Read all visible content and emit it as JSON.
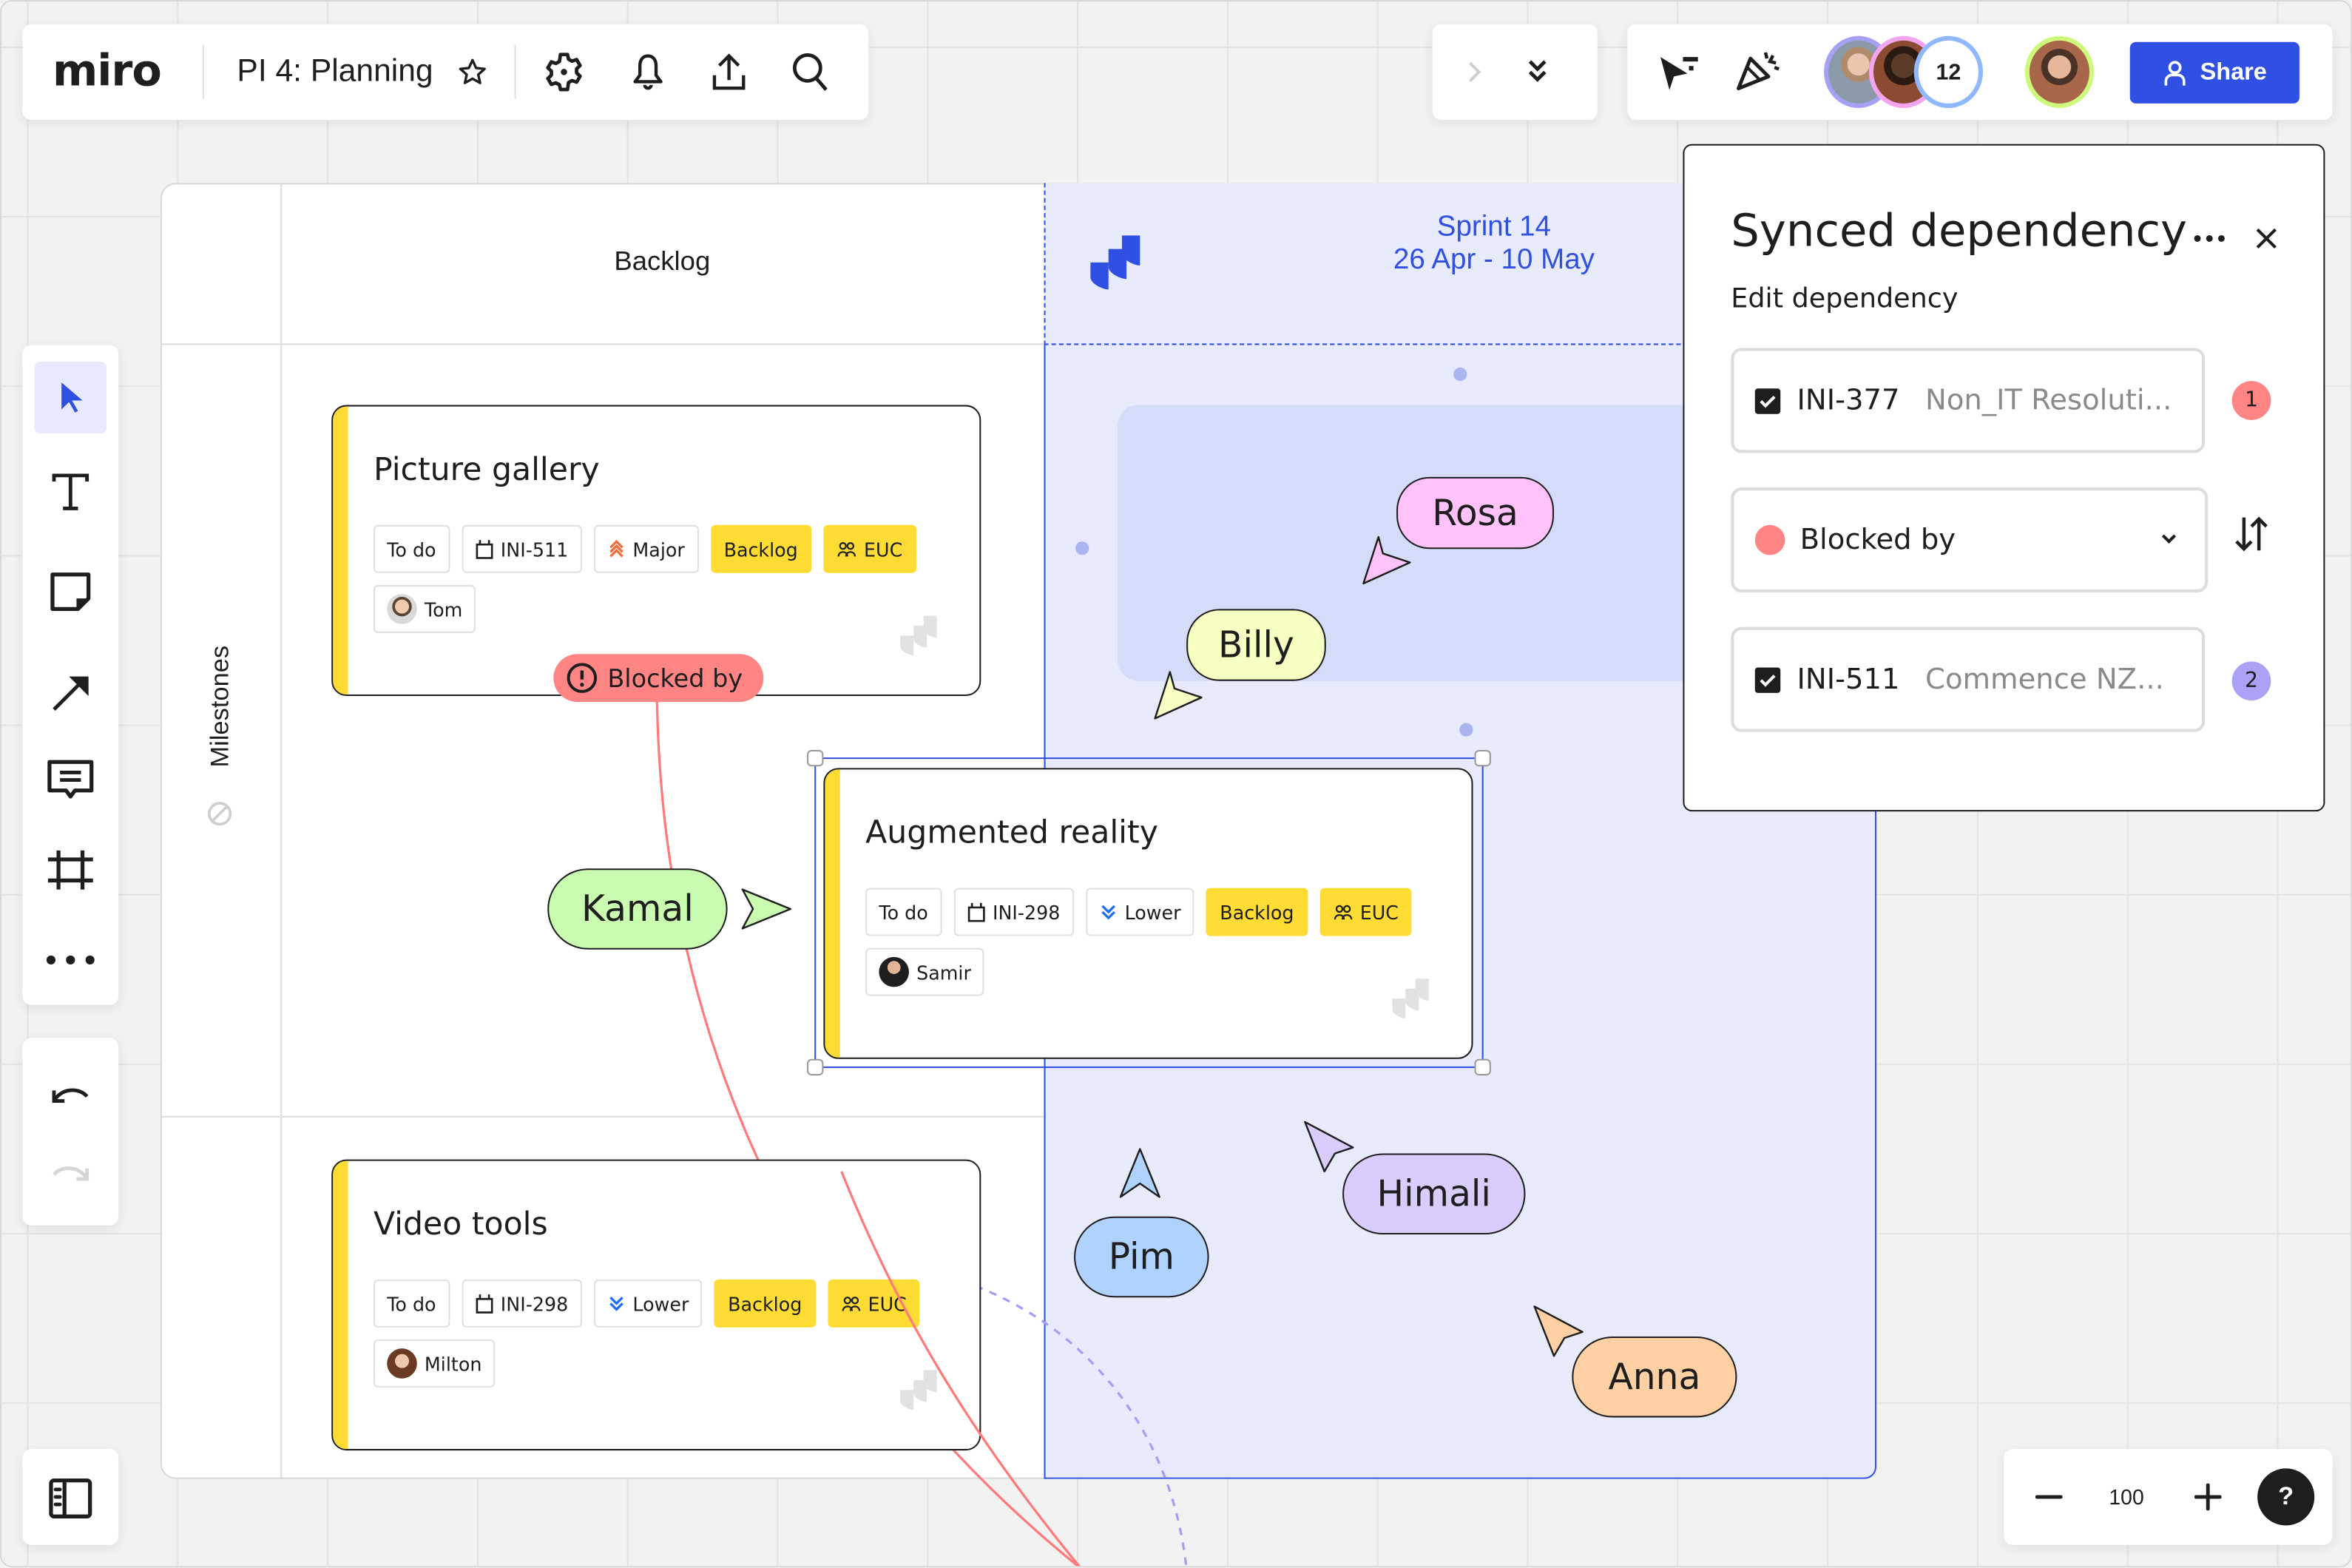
{
  "topbar": {
    "logo": "miro",
    "board_title": "PI 4: Planning",
    "icons": [
      "star-icon",
      "settings-icon",
      "bell-icon",
      "export-icon",
      "search-icon"
    ]
  },
  "top_right": {
    "collapse_icons": [
      "chevron-right-icon",
      "double-chevron-down-icon"
    ],
    "tool_icons": [
      "cursor-follow-icon",
      "celebrate-icon"
    ],
    "collaborator_count": "12",
    "share_label": "Share",
    "colors": {
      "share": "#3050e4"
    }
  },
  "left_toolbar": {
    "tools": [
      "select",
      "text",
      "sticky-note",
      "arrow",
      "comment",
      "frame",
      "more"
    ],
    "active_tool": "select"
  },
  "board": {
    "columns": {
      "backlog": "Backlog",
      "sprint_name": "Sprint 14",
      "sprint_dates": "26 Apr - 10 May"
    },
    "row_label": "Milestones",
    "cards": [
      {
        "title": "Picture gallery",
        "status": "To do",
        "key": "INI-511",
        "priority": "Major",
        "column": "Backlog",
        "team": "EUC",
        "assignee": "Tom"
      },
      {
        "title": "Augmented reality",
        "status": "To do",
        "key": "INI-298",
        "priority": "Lower",
        "column": "Backlog",
        "team": "EUC",
        "assignee": "Samir"
      },
      {
        "title": "Video tools",
        "status": "To do",
        "key": "INI-298",
        "priority": "Lower",
        "column": "Backlog",
        "team": "EUC",
        "assignee": "Milton"
      }
    ],
    "dependency_tag": "Blocked by",
    "colors": {
      "card_stripe": "#ffdc33",
      "dependency": "#ff8585",
      "sprint_bg": "#e8ebfb",
      "accent": "#3050e4"
    }
  },
  "cursors": [
    {
      "name": "Rosa",
      "color": "#ffc2fb"
    },
    {
      "name": "Billy",
      "color": "#f7ffc2"
    },
    {
      "name": "Kamal",
      "color": "#c9fcb0"
    },
    {
      "name": "Himali",
      "color": "#d8cdfd"
    },
    {
      "name": "Pim",
      "color": "#b0d2ff"
    },
    {
      "name": "Anna",
      "color": "#ffd0a3"
    }
  ],
  "side_panel": {
    "title": "Synced dependency",
    "subtitle": "Edit dependency",
    "source_issue": {
      "key": "INI-377",
      "summary": "Non_IT Resoluti...",
      "checked": true,
      "badge": "1"
    },
    "relation": {
      "label": "Blocked by",
      "color": "#ff8585"
    },
    "target_issue": {
      "key": "INI-511",
      "summary": "Commence NZ...",
      "checked": true,
      "badge": "2"
    }
  },
  "zoom_controls": {
    "value": "100",
    "help": "?"
  }
}
